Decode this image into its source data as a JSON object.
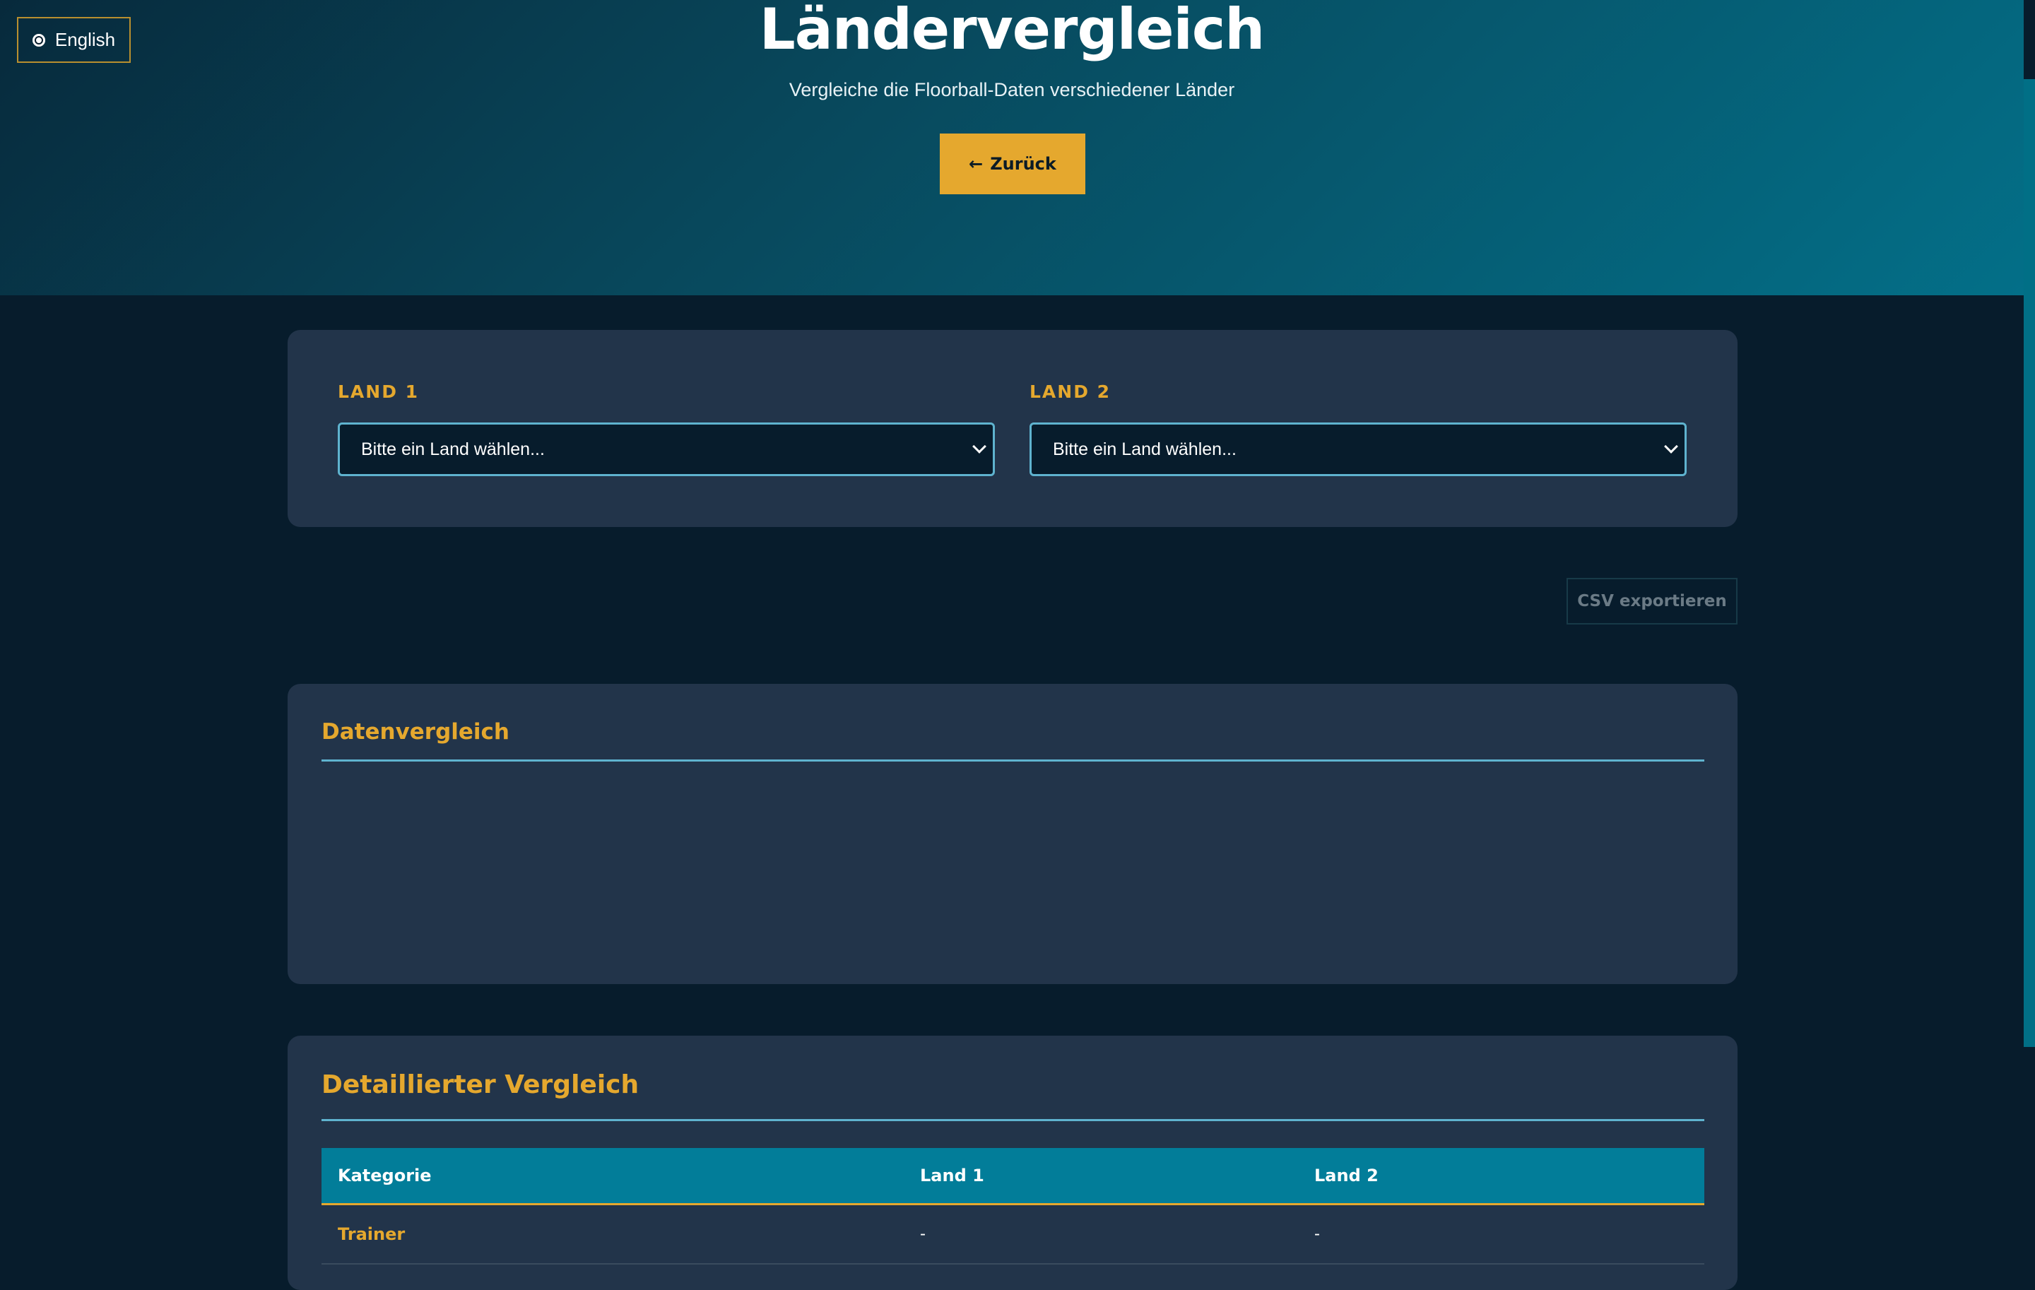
{
  "language_button": {
    "icon": "globe-icon",
    "label": "English"
  },
  "hero": {
    "title": "Ländervergleich",
    "subtitle": "Vergleiche die Floorball-Daten verschiedener Länder",
    "back_button": {
      "arrow": "←",
      "label": "Zurück"
    }
  },
  "selection": {
    "country1": {
      "label": "LAND 1",
      "value": "Bitte ein Land wählen..."
    },
    "country2": {
      "label": "LAND 2",
      "value": "Bitte ein Land wählen..."
    }
  },
  "export": {
    "csv_label": "CSV exportieren"
  },
  "data_comparison": {
    "title": "Datenvergleich"
  },
  "detailed_comparison": {
    "title": "Detaillierter Vergleich",
    "columns": [
      "Kategorie",
      "Land 1",
      "Land 2"
    ],
    "rows": [
      {
        "category": "Trainer",
        "land1": "-",
        "land2": "-"
      }
    ]
  },
  "colors": {
    "accent": "#e5a82e",
    "teal": "#027d99",
    "background": "#071c2c",
    "card": "#22344a"
  }
}
